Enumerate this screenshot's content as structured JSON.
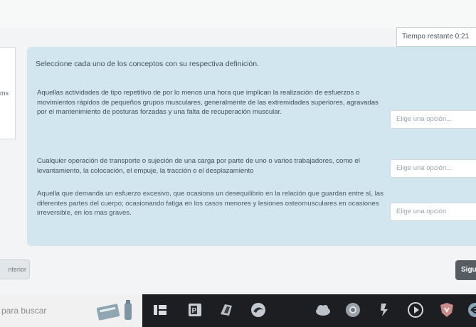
{
  "header": {
    "timer_label": "Tiempo restante 0:21"
  },
  "side": {
    "fragment_text": "ms"
  },
  "question": {
    "instruction": "Seleccione cada uno de los conceptos con su respectiva definición.",
    "rows": [
      {
        "definition": "Aquellas actividades de tipo repetitivo de por lo menos una hora que implican la realización de esfuerzos o movimientos rápidos de pequeños grupos musculares, generalmente de las extremidades superiores, agravadas por el mantenimiento de posturas forzadas y una falta de recuperación muscular.",
        "select_placeholder": "Elige una opción..."
      },
      {
        "definition": "Cualquier operación de transporte o sujeción de una carga por parte de uno o varios trabajadores, como el levantamiento, la colocación, el empuje, la tracción o el desplazamiento",
        "select_placeholder": "Elige una opción..."
      },
      {
        "definition": "Aquella que demanda un esfuerzo excesivo, que ocasiona un desequilibrio en la relación que guardan entre sí, las diferentes partes del cuerpo; ocasionando fatiga en los casos menores y lesiones osteomusculares en ocasiones irreversible, en los mas graves.",
        "select_placeholder": "Elige una opción"
      }
    ]
  },
  "navigation": {
    "prev_label": "nterior",
    "next_label": "Sigu"
  },
  "taskbar": {
    "search_placeholder": "para buscar",
    "icons": [
      "task-view-icon",
      "powerpoint-icon",
      "file-explorer-icon",
      "browser-icon",
      "cloud-icon",
      "chrome-icon",
      "app-icon",
      "media-player-icon",
      "shield-icon",
      "edge-icon"
    ]
  },
  "colors": {
    "panel": "#d1e6ee",
    "taskbar": "#1c1e22",
    "next_button": "#555c62"
  }
}
